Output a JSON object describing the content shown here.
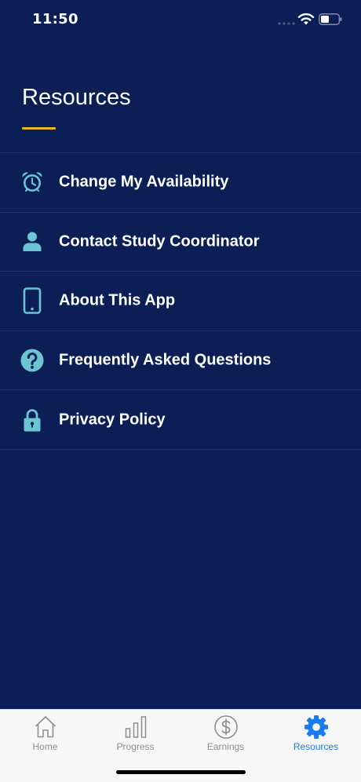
{
  "status_bar": {
    "time": "11:50",
    "icons": [
      "signal-icon",
      "wifi-icon",
      "battery-icon"
    ]
  },
  "page": {
    "title": "Resources"
  },
  "menu": {
    "items": [
      {
        "label": "Change My Availability",
        "icon": "alarm-clock-icon"
      },
      {
        "label": "Contact Study Coordinator",
        "icon": "person-icon"
      },
      {
        "label": "About This App",
        "icon": "phone-icon"
      },
      {
        "label": "Frequently Asked Questions",
        "icon": "question-icon"
      },
      {
        "label": "Privacy Policy",
        "icon": "lock-icon"
      }
    ]
  },
  "tab_bar": {
    "tabs": [
      {
        "label": "Home",
        "icon": "home-icon",
        "active": false
      },
      {
        "label": "Progress",
        "icon": "bar-chart-icon",
        "active": false
      },
      {
        "label": "Earnings",
        "icon": "dollar-icon",
        "active": false
      },
      {
        "label": "Resources",
        "icon": "gear-icon",
        "active": true
      }
    ]
  },
  "colors": {
    "background": "#0b1e55",
    "accent_underline": "#e8b61c",
    "icon_teal": "#6cc4d2",
    "tab_active": "#1a7cf0",
    "tab_inactive": "#8e8e93"
  }
}
